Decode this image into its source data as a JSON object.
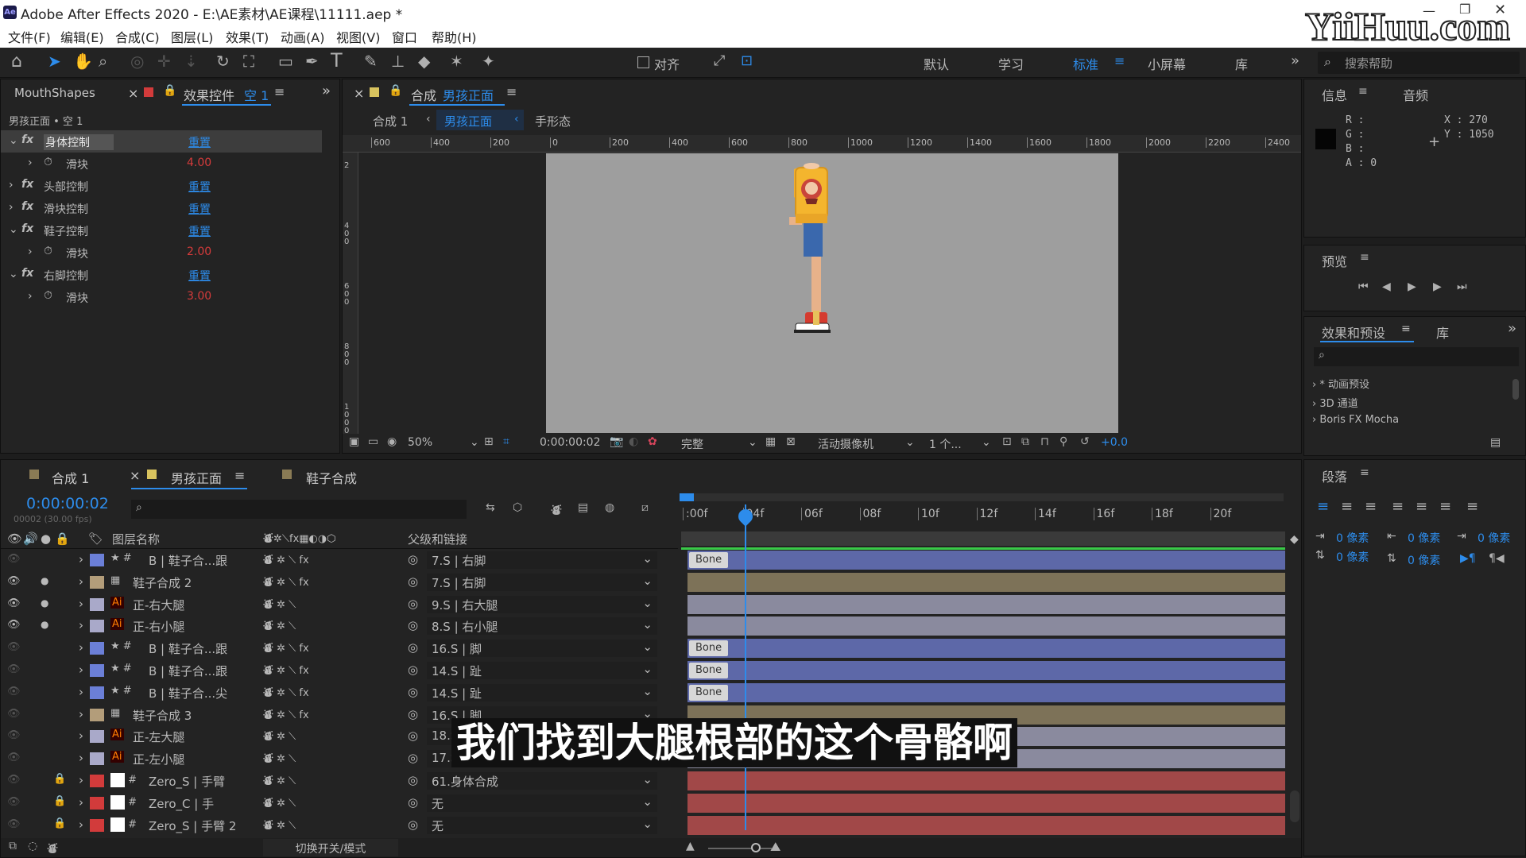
{
  "window": {
    "title": "Adobe After Effects 2020 - E:\\AE素材\\AE课程\\11111.aep *",
    "watermark": "YiiHuu.com"
  },
  "menu": [
    "文件(F)",
    "编辑(E)",
    "合成(C)",
    "图层(L)",
    "效果(T)",
    "动画(A)",
    "视图(V)",
    "窗口",
    "帮助(H)"
  ],
  "toolbar": {
    "align_label": "对齐",
    "workspaces": [
      "默认",
      "学习",
      "标准",
      "小屏幕",
      "库"
    ],
    "search_placeholder": "搜索帮助"
  },
  "effects_panel": {
    "tab_left": "MouthShapes",
    "tab_main": "效果控件",
    "tab_main_target": "空 1",
    "crumb": "男孩正面 • 空 1",
    "items": [
      {
        "name": "身体控制",
        "reset": "重置",
        "expanded": true,
        "selected": true
      },
      {
        "name": "滑块",
        "value": "4.00",
        "sub": true
      },
      {
        "name": "头部控制",
        "reset": "重置"
      },
      {
        "name": "滑块控制",
        "reset": "重置"
      },
      {
        "name": "鞋子控制",
        "reset": "重置",
        "expanded": true
      },
      {
        "name": "滑块",
        "value": "2.00",
        "sub": true
      },
      {
        "name": "右脚控制",
        "reset": "重置",
        "expanded": true
      },
      {
        "name": "滑块",
        "value": "3.00",
        "sub": true
      }
    ]
  },
  "comp_panel": {
    "tab_prefix": "合成",
    "tab_name": "男孩正面",
    "crumbs": [
      "合成 1",
      "男孩正面",
      "手形态"
    ],
    "ruler": [
      "600",
      "400",
      "200",
      "0",
      "200",
      "400",
      "600",
      "800",
      "1000",
      "1200",
      "1400",
      "1600",
      "1800",
      "2000",
      "2200",
      "2400"
    ],
    "vruler": [
      "2",
      "4 0 0",
      "6 0 0",
      "8 0 0",
      "1 0 0 0"
    ],
    "zoom": "50%",
    "timecode": "0:00:00:02",
    "quality": "完整",
    "camera": "活动摄像机",
    "views": "1 个...",
    "exposure": "+0.0"
  },
  "info_panel": {
    "title": "信息",
    "tab2": "音频",
    "r": "R :",
    "g": "G :",
    "b": "B :",
    "a": "A : 0",
    "x": "X : 270",
    "y": "Y : 1050"
  },
  "preview_panel": {
    "title": "预览"
  },
  "effects_presets": {
    "title": "效果和预设",
    "tab2": "库",
    "items": [
      "* 动画预设",
      "3D 通道",
      "Boris FX Mocha"
    ]
  },
  "paragraph_panel": {
    "title": "段落",
    "values": [
      "0 像素",
      "0 像素",
      "0 像素",
      "0 像素",
      "0 像素",
      "0 像素",
      "0 像素"
    ]
  },
  "timeline": {
    "tabs": [
      "合成 1",
      "男孩正面",
      "鞋子合成"
    ],
    "timecode": "0:00:00:02",
    "fps": "00002 (30.00 fps)",
    "col_name": "图层名称",
    "col_parent": "父级和链接",
    "ticks": [
      ":00f",
      "04f",
      "06f",
      "08f",
      "10f",
      "12f",
      "14f",
      "16f",
      "18f",
      "20f"
    ],
    "footer": "切换开关/模式",
    "layers": [
      {
        "name": "B | 鞋子合...跟",
        "parent": "7.S | 右脚",
        "color": "#6b7fd7",
        "type": "star",
        "bar": "#5d68a8",
        "bone": "Bone",
        "vis": false
      },
      {
        "name": "鞋子合成 2",
        "parent": "7.S | 右脚",
        "color": "#b39d7a",
        "type": "comp",
        "bar": "#7d7258",
        "vis": true
      },
      {
        "name": "正-右大腿",
        "parent": "9.S | 右大腿",
        "color": "#a9a9c9",
        "type": "ai",
        "bar": "#8a8a9e",
        "vis": true
      },
      {
        "name": "正-右小腿",
        "parent": "8.S | 右小腿",
        "color": "#a9a9c9",
        "type": "ai",
        "bar": "#8a8a9e",
        "vis": true
      },
      {
        "name": "B | 鞋子合...跟",
        "parent": "16.S | 脚",
        "color": "#6b7fd7",
        "type": "star",
        "bar": "#5d68a8",
        "bone": "Bone",
        "vis": false
      },
      {
        "name": "B | 鞋子合...跟",
        "parent": "14.S | 趾",
        "color": "#6b7fd7",
        "type": "star",
        "bar": "#5d68a8",
        "bone": "Bone",
        "vis": false
      },
      {
        "name": "B | 鞋子合...尖",
        "parent": "14.S | 趾",
        "color": "#6b7fd7",
        "type": "star",
        "bar": "#5d68a8",
        "bone": "Bone",
        "vis": false
      },
      {
        "name": "鞋子合成 3",
        "parent": "16.S | 脚",
        "color": "#b39d7a",
        "type": "comp",
        "bar": "#7d7258",
        "vis": false
      },
      {
        "name": "正-左大腿",
        "parent": "18.S",
        "color": "#a9a9c9",
        "type": "ai",
        "bar": "#8a8a9e",
        "vis": false
      },
      {
        "name": "正-左小腿",
        "parent": "17.S",
        "color": "#a9a9c9",
        "type": "ai",
        "bar": "#8a8a9e",
        "vis": false
      },
      {
        "name": "Zero_S | 手臂",
        "parent": "61.身体合成",
        "color": "#d23b3b",
        "type": "null",
        "bar": "#a14848",
        "lock": true,
        "vis": false
      },
      {
        "name": "Zero_C | 手",
        "parent": "无",
        "color": "#d23b3b",
        "type": "null",
        "bar": "#a14848",
        "lock": true,
        "vis": false
      },
      {
        "name": "Zero_S | 手臂 2",
        "parent": "无",
        "color": "#d23b3b",
        "type": "null",
        "bar": "#a14848",
        "lock": true,
        "vis": false
      }
    ]
  },
  "subtitle": "我们找到大腿根部的这个骨骼啊"
}
